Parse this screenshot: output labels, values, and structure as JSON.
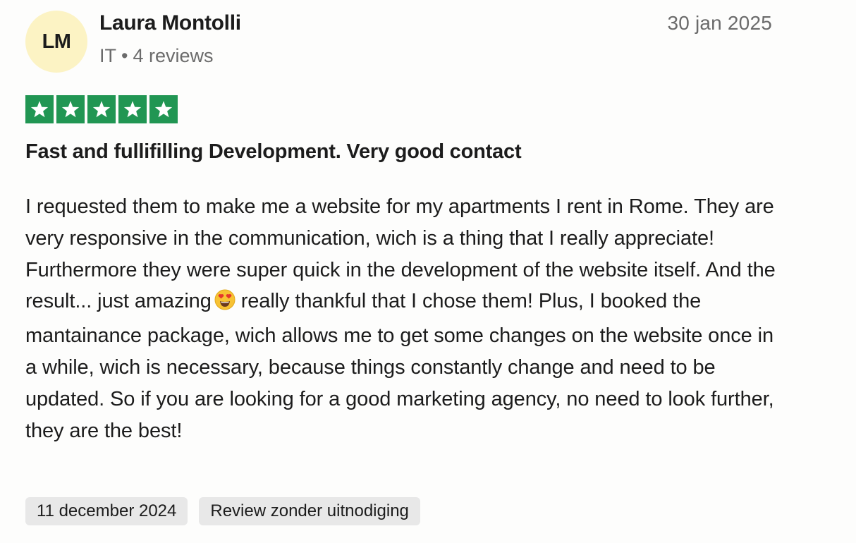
{
  "review": {
    "avatar_initials": "LM",
    "avatar_color": "#fcf3c4",
    "author_name": "Laura Montolli",
    "author_country": "IT",
    "meta_separator": "•",
    "author_review_count": "4 reviews",
    "date": "30 jan 2025",
    "rating": 5,
    "rating_max": 5,
    "star_color": "#219653",
    "title": "Fast and fullifilling Development. Very good contact",
    "body": "I requested them to make me a website for my apartments I rent in Rome. They are very responsive in the communication, wich is a thing that I really appreciate! Furthermore they were super quick in the development of the website itself. And the result... just amazing",
    "body_emoji": "heart-eyes-emoji",
    "body_continued": "really thankful that I chose them! Plus, I booked the mantainance package, wich allows me to get some changes on the website once in a while, wich is necessary, because things constantly change and need to be updated. So if you are looking for a good marketing agency, no need to look further, they are the best!",
    "experience_date": "11 december 2024",
    "review_type": "Review zonder uitnodiging"
  }
}
